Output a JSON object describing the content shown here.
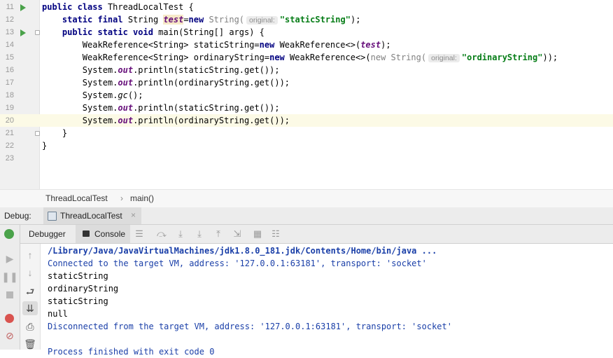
{
  "editor": {
    "lines": [
      {
        "num": "11",
        "runnable": true
      },
      {
        "num": "12"
      },
      {
        "num": "13",
        "runnable": true
      },
      {
        "num": "14"
      },
      {
        "num": "15"
      },
      {
        "num": "16"
      },
      {
        "num": "17"
      },
      {
        "num": "18"
      },
      {
        "num": "19"
      },
      {
        "num": "20",
        "current": true
      },
      {
        "num": "21"
      },
      {
        "num": "22"
      },
      {
        "num": "23"
      }
    ],
    "code": {
      "l11": {
        "public": "public",
        "class": "class",
        "name": " ThreadLocalTest {"
      },
      "l12": {
        "kw": "static final",
        "type": " String ",
        "field": "test",
        "eq": "=",
        "new": "new",
        "ctor": " String(",
        "hint": "original:",
        "str": "\"staticString\"",
        "end": ");"
      },
      "l13": {
        "kw": "public static void",
        "rest": " main(String[] args) {"
      },
      "l14": {
        "pre": "WeakReference<String> staticString=",
        "new": "new",
        "mid": " WeakReference<>(",
        "field": "test",
        "end": ");"
      },
      "l15": {
        "pre": "WeakReference<String> ordinaryString=",
        "new": "new",
        "mid": " WeakReference<>(",
        "new2": "new",
        "ctor": " String(",
        "hint": "original:",
        "str": "\"ordinaryString\"",
        "end": "));"
      },
      "l16": {
        "a": "System.",
        "out": "out",
        "b": ".println(staticString.get());"
      },
      "l17": {
        "a": "System.",
        "out": "out",
        "b": ".println(ordinaryString.get());"
      },
      "l18": {
        "a": "System.",
        "gc": "gc",
        "b": "();"
      },
      "l19": {
        "a": "System.",
        "out": "out",
        "b": ".println(staticString.get());"
      },
      "l20": {
        "a": "System.",
        "out": "out",
        "b": ".println(ordinaryString.get());"
      },
      "l21": {
        "text": "}"
      },
      "l22": {
        "text": "}"
      }
    }
  },
  "breadcrumb": {
    "class_name": "ThreadLocalTest",
    "sep": "›",
    "method": "main()"
  },
  "debug": {
    "label": "Debug:",
    "tab_title": "ThreadLocalTest",
    "tab_close": "×",
    "tabs": {
      "debugger": "Debugger",
      "console": "Console"
    }
  },
  "console": {
    "lines": [
      "/Library/Java/JavaVirtualMachines/jdk1.8.0_181.jdk/Contents/Home/bin/java ...",
      "Connected to the target VM, address: '127.0.0.1:63181', transport: 'socket'",
      "staticString",
      "ordinaryString",
      "staticString",
      "null",
      "Disconnected from the target VM, address: '127.0.0.1:63181', transport: 'socket'",
      "Process finished with exit code 0"
    ]
  },
  "colors": {
    "run": "#4aa24a",
    "keyword": "#000080",
    "string": "#067d17",
    "field": "#660e7a",
    "console_link": "#1a3fa8",
    "current_line": "#fcfae6"
  },
  "icons": [
    "run-gutter-icon",
    "fold-icon",
    "class-tab-icon",
    "close-tab-icon",
    "debug-bug-icon",
    "resume-icon",
    "pause-icon",
    "stop-icon",
    "breakpoints-icon",
    "mute-breakpoints-icon",
    "up-icon",
    "down-icon",
    "wrap-icon",
    "scroll-end-icon",
    "print-icon",
    "trash-icon",
    "list-icon",
    "step-over-icon",
    "step-into-icon",
    "force-step-into-icon",
    "step-out-icon",
    "run-to-cursor-icon",
    "evaluate-icon",
    "trace-icon"
  ]
}
